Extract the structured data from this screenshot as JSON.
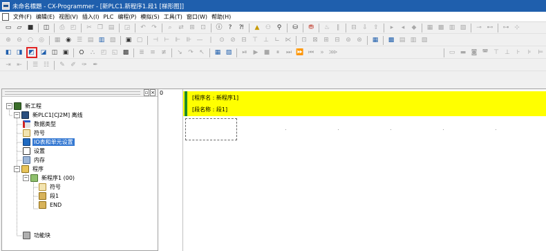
{
  "window": {
    "title": "未命名標題 - CX-Programmer - [新PLC1.新程序1.段1 [梯形图]]"
  },
  "menu": {
    "items": [
      "文件(F)",
      "编辑(E)",
      "视图(V)",
      "插入(I)",
      "PLC",
      "编程(P)",
      "模拟(S)",
      "工具(T)",
      "窗口(W)",
      "帮助(H)"
    ]
  },
  "toolbars": {
    "row1_icons": [
      "new-file-icon",
      "open-file-icon",
      "save-icon",
      "separator",
      "project-icon",
      "separator",
      "print-icon",
      "print-preview-icon",
      "separator",
      "cut-icon",
      "copy-icon",
      "paste-icon",
      "separator",
      "find-icon",
      "separator",
      "undo-icon",
      "redo-icon",
      "separator",
      "find-replace-icon",
      "separator",
      "about-icon",
      "help-icon",
      "whats-this-icon",
      "separator",
      "warning-icon",
      "separator",
      "cross-ref-icon",
      "separator",
      "go-online-icon",
      "separator",
      "transfer-icon",
      "separator",
      "compile-icon",
      "separator"
    ],
    "row2_icons": [
      "zoom-in-icon",
      "zoom-out-icon",
      "zoom-icon",
      "zoom-fit-icon",
      "separator",
      "grid-icon",
      "list-icon",
      "monitor-icon",
      "table-icon",
      "separator",
      "contact-icon",
      "closed-contact-icon",
      "coil-icon",
      "separator"
    ],
    "row3_icons": [
      "project-panel-icon",
      "output-icon",
      "watch-icon",
      "address-ref-icon",
      "properties-icon",
      "separator",
      "mnemonic-icon",
      "separator",
      "ladder-icon",
      "st-icon",
      "sfc-icon",
      "separator"
    ],
    "row4_icons": [
      "indent-icon",
      "outdent-icon",
      "separator",
      "align-left-icon",
      "align-right-icon",
      "separator",
      "bookmark-icon",
      "next-bookmark-icon"
    ]
  },
  "project_tree": {
    "nodes": [
      {
        "label": "新工程",
        "icon": "project-icon",
        "expander": "−"
      },
      {
        "label": "新PLC1[CJ2M] 离线",
        "icon": "plc-icon",
        "expander": "−"
      },
      {
        "label": "数据类型",
        "icon": "data-type-icon"
      },
      {
        "label": "符号",
        "icon": "symbols-icon"
      },
      {
        "label": "IO表和单元设置",
        "icon": "io-table-icon",
        "selected": true
      },
      {
        "label": "设置",
        "icon": "settings-icon"
      },
      {
        "label": "内存",
        "icon": "memory-icon"
      },
      {
        "label": "程序",
        "icon": "programs-icon",
        "expander": "−"
      },
      {
        "label": "新程序1 (00)",
        "icon": "program-icon",
        "expander": "−"
      },
      {
        "label": "符号",
        "icon": "symbols-icon"
      },
      {
        "label": "段1",
        "icon": "section-icon"
      },
      {
        "label": "END",
        "icon": "section-icon"
      },
      {
        "label": "功能块",
        "icon": "function-block-icon"
      }
    ]
  },
  "ladder": {
    "rung_number": "0",
    "program_name_line": "[程序名 : 新程序1]",
    "section_name_line": "[段名称 : 段1]"
  },
  "colors": {
    "title_bar": "#1f5fad",
    "header_background": "#ffff00",
    "header_left_bar": "#1f8a2a",
    "selection": "#3478d2",
    "highlight_box": "#e02020"
  }
}
